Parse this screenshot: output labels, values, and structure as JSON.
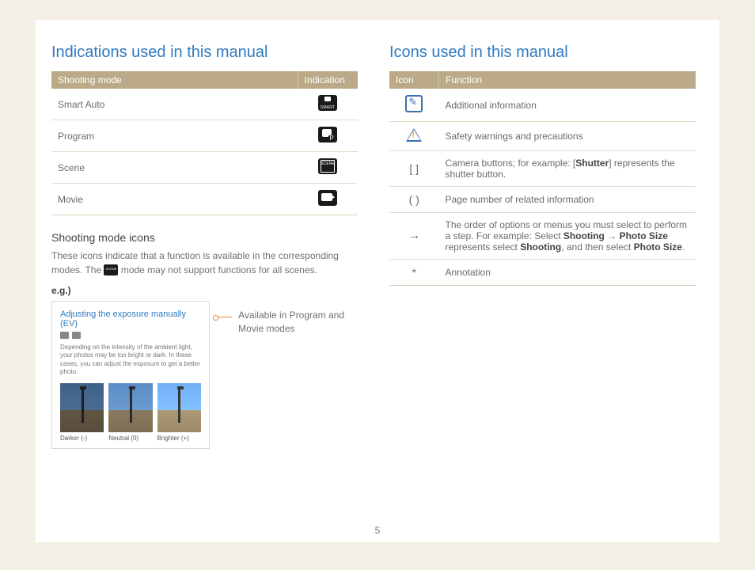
{
  "left": {
    "heading": "Indications used in this manual",
    "table_headers": {
      "col1": "Shooting mode",
      "col2": "Indication"
    },
    "rows": [
      {
        "mode": "Smart Auto"
      },
      {
        "mode": "Program"
      },
      {
        "mode": "Scene"
      },
      {
        "mode": "Movie"
      }
    ],
    "subheading": "Shooting mode icons",
    "desc_before": "These icons indicate that a function is available in the corresponding modes. The ",
    "desc_after": " mode may not support functions for all scenes.",
    "eg_label": "e.g.)",
    "example": {
      "title": "Adjusting the exposure manually (EV)",
      "desc": "Depending on the intensity of the ambient light, your photos may be too bright or dark. In these cases, you can adjust the exposure to get a better photo.",
      "thumbs": [
        {
          "label": "Darker (-)"
        },
        {
          "label": "Neutral (0)"
        },
        {
          "label": "Brighter (+)"
        }
      ]
    },
    "callout": "Available in Program and Movie modes"
  },
  "right": {
    "heading": "Icons used in this manual",
    "table_headers": {
      "col1": "Icon",
      "col2": "Function"
    },
    "rows": {
      "info": "Additional information",
      "warn": "Safety warnings and precautions",
      "brackets_sym": "[  ]",
      "brackets_before": "Camera buttons; for example: [",
      "brackets_bold": "Shutter",
      "brackets_after": "] represents the shutter button.",
      "parens_sym": "(  )",
      "parens": "Page number of related information",
      "arrow_sym": "→",
      "arrow_before": "The order of options or menus you must select to perform a step. For example: Select ",
      "arrow_b1": "Shooting",
      "arrow_mid1": " → ",
      "arrow_b2": "Photo Size",
      "arrow_mid2": " represents select ",
      "arrow_b3": "Shooting",
      "arrow_mid3": ", and then select ",
      "arrow_b4": "Photo Size",
      "arrow_end": ".",
      "star_sym": "*",
      "star": "Annotation"
    }
  },
  "page_number": "5"
}
